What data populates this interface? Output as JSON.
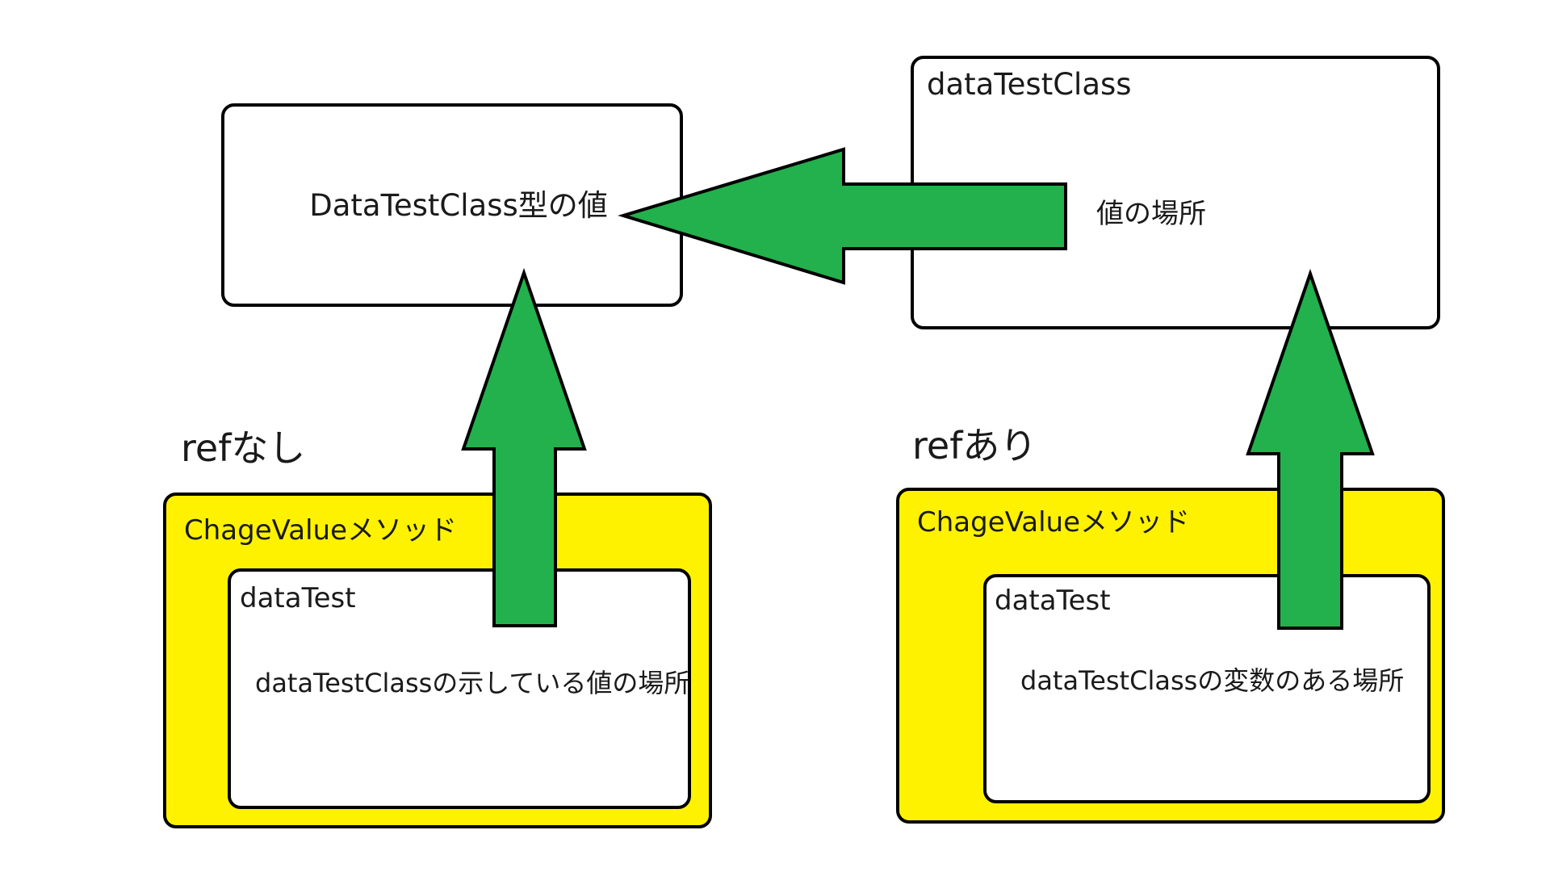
{
  "value_box": {
    "label": "DataTestClass型の値"
  },
  "class_box": {
    "title": "dataTestClass",
    "label": "値の場所"
  },
  "left_section": {
    "heading": "refなし",
    "method": {
      "title": "ChageValueメソッド",
      "variable": {
        "title": "dataTest",
        "label": "dataTestClassの示している値の場所"
      }
    }
  },
  "right_section": {
    "heading": "refあり",
    "method": {
      "title": "ChageValueメソッド",
      "variable": {
        "title": "dataTest",
        "label": "dataTestClassの変数のある場所"
      }
    }
  },
  "colors": {
    "arrow_fill": "#22b14c",
    "method_fill": "#fff200",
    "stroke": "#000000",
    "box_fill": "#ffffff"
  },
  "icons": {
    "horizontal_arrow": "arrow-left",
    "vertical_arrows": "arrow-up"
  }
}
